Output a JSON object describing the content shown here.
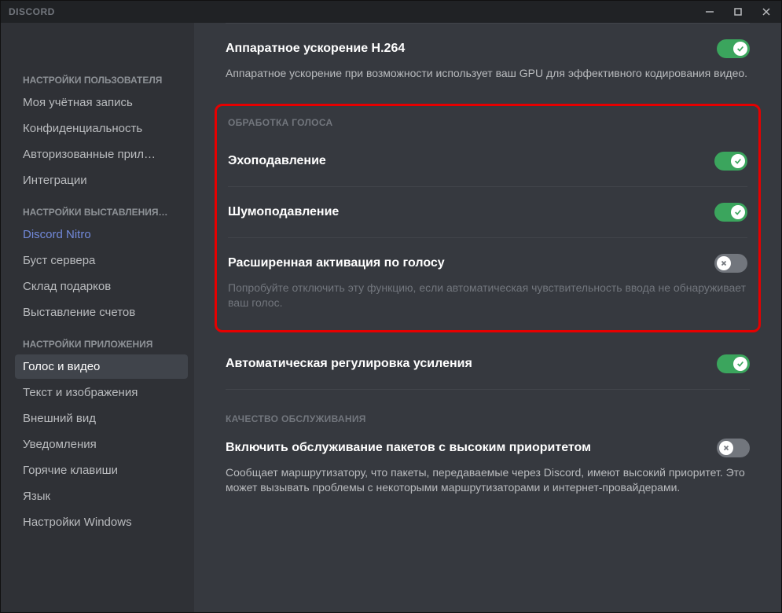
{
  "titlebar": {
    "title": "DISCORD"
  },
  "sidebar": {
    "groups": [
      {
        "header": "НАСТРОЙКИ ПОЛЬЗОВАТЕЛЯ",
        "items": [
          {
            "label": "Моя учётная запись",
            "kind": "normal"
          },
          {
            "label": "Конфиденциальность",
            "kind": "normal"
          },
          {
            "label": "Авторизованные прил…",
            "kind": "normal"
          },
          {
            "label": "Интеграции",
            "kind": "normal"
          }
        ]
      },
      {
        "header": "НАСТРОЙКИ ВЫСТАВЛЕНИЯ…",
        "items": [
          {
            "label": "Discord Nitro",
            "kind": "nitro"
          },
          {
            "label": "Буст сервера",
            "kind": "normal"
          },
          {
            "label": "Склад подарков",
            "kind": "normal"
          },
          {
            "label": "Выставление счетов",
            "kind": "normal"
          }
        ]
      },
      {
        "header": "НАСТРОЙКИ ПРИЛОЖЕНИЯ",
        "items": [
          {
            "label": "Голос и видео",
            "kind": "active"
          },
          {
            "label": "Текст и изображения",
            "kind": "normal"
          },
          {
            "label": "Внешний вид",
            "kind": "normal"
          },
          {
            "label": "Уведомления",
            "kind": "normal"
          },
          {
            "label": "Горячие клавиши",
            "kind": "normal"
          },
          {
            "label": "Язык",
            "kind": "normal"
          },
          {
            "label": "Настройки Windows",
            "kind": "normal"
          }
        ]
      }
    ]
  },
  "settings": {
    "hw_accel": {
      "title": "Аппаратное ускорение H.264",
      "desc": "Аппаратное ускорение при возможности использует ваш GPU для эффективного кодирования видео.",
      "on": true
    },
    "voice_processing_header": "ОБРАБОТКА ГОЛОСА",
    "echo": {
      "title": "Эхоподавление",
      "on": true
    },
    "noise": {
      "title": "Шумоподавление",
      "on": true
    },
    "voice_activity": {
      "title": "Расширенная активация по голосу",
      "desc": "Попробуйте отключить эту функцию, если автоматическая чувствительность ввода не обнаруживает ваш голос.",
      "on": false
    },
    "auto_gain": {
      "title": "Автоматическая регулировка усиления",
      "on": true
    },
    "qos_header": "КАЧЕСТВО ОБСЛУЖИВАНИЯ",
    "qos": {
      "title": "Включить обслуживание пакетов с высоким приоритетом",
      "desc": "Сообщает маршрутизатору, что пакеты, передаваемые через Discord, имеют высокий приоритет. Это может вызывать проблемы с некоторыми маршрутизаторами и интернет-провайдерами.",
      "on": false
    }
  }
}
